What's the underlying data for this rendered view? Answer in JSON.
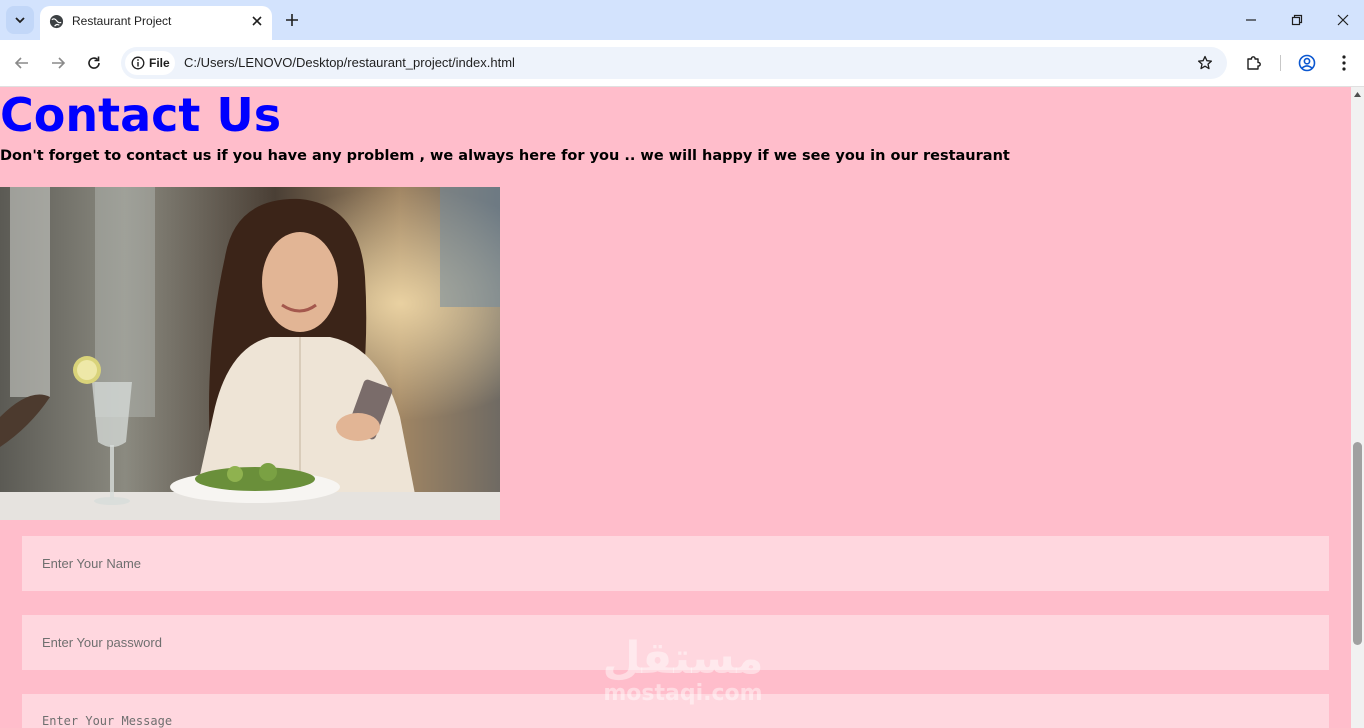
{
  "browser": {
    "tab_title": "Restaurant Project",
    "scheme_label": "File",
    "url": "C:/Users/LENOVO/Desktop/restaurant_project/index.html"
  },
  "page": {
    "heading": "Contact Us",
    "subtext": "Don't forget to contact us if you have any problem , we always here for you .. we will happy if we see you in our restaurant",
    "form": {
      "name_placeholder": "Enter Your Name",
      "password_placeholder": "Enter Your password",
      "message_placeholder": "Enter Your Message"
    },
    "watermark_arabic": "مستقل",
    "watermark_latin": "mostaqi.com"
  },
  "colors": {
    "page_background": "#ffbdcb",
    "heading": "#0000ff",
    "input_background": "#ffd7df",
    "tabstrip": "#d3e3fd"
  }
}
